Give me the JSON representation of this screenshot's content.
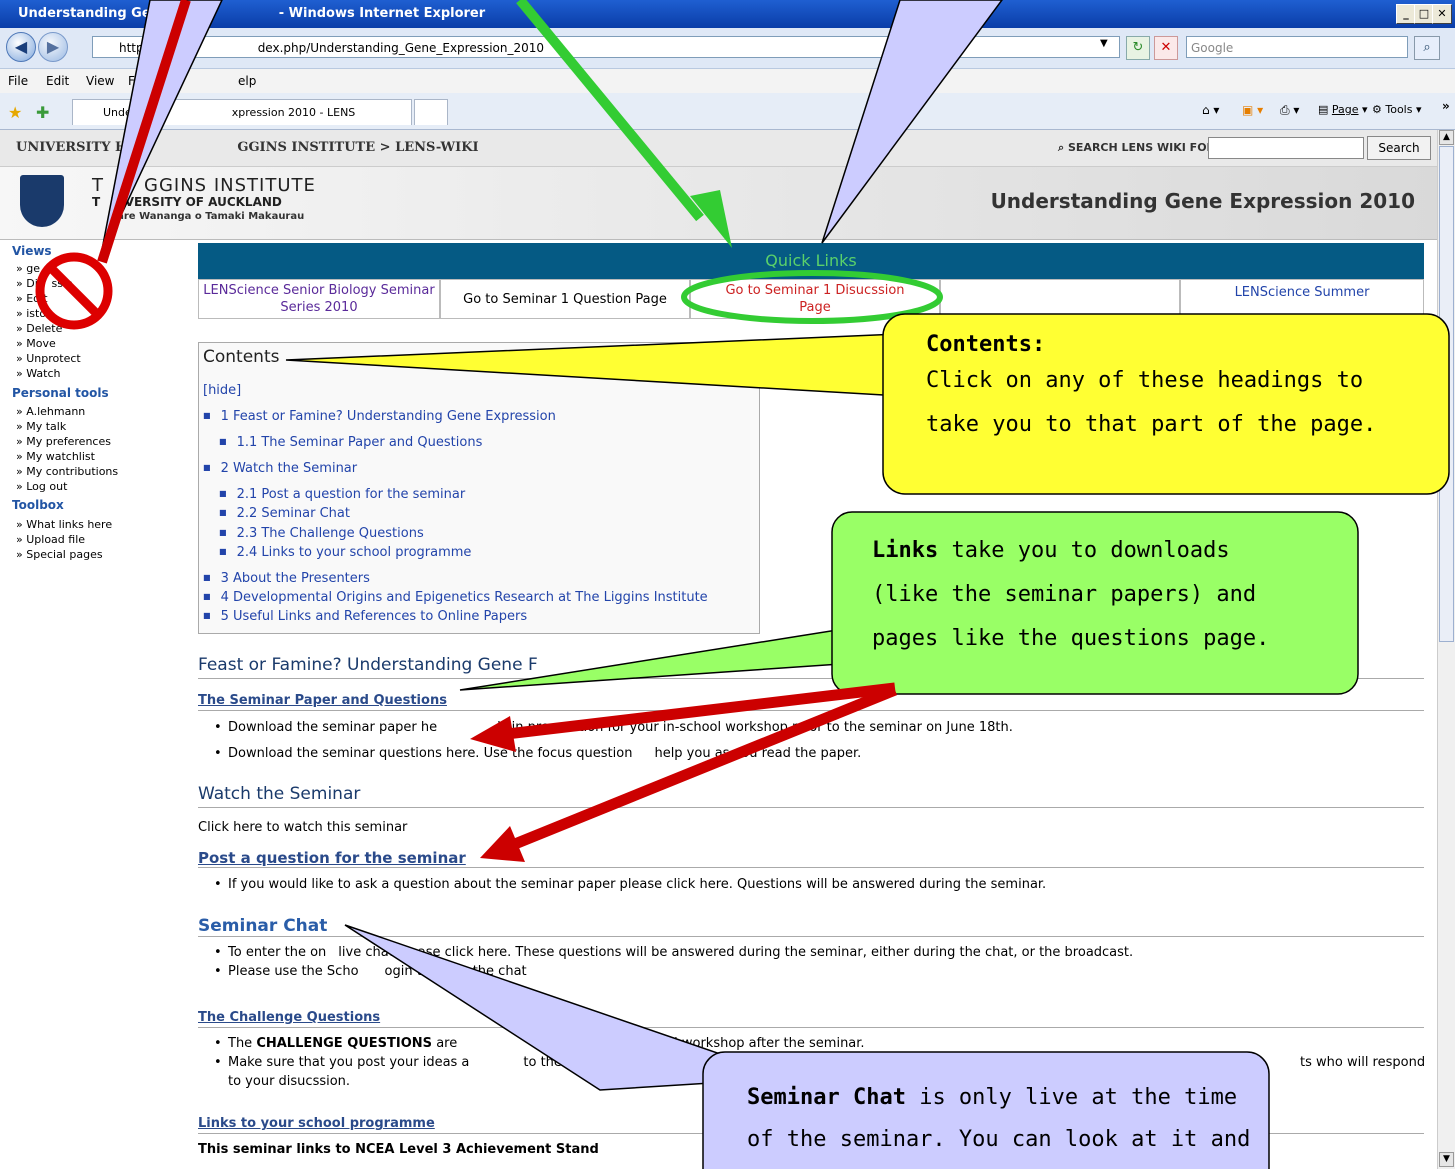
{
  "browser": {
    "title": "Understanding Gene",
    "title_suffix": "- Windows Internet Explorer",
    "url_prefix": "http:",
    "url_suffix": "dex.php/Understanding_Gene_Expression_2010",
    "search_engine": "Google",
    "menu": [
      "File",
      "Edit",
      "View",
      "F",
      "elp"
    ],
    "tab_label_left": "Unde",
    "tab_label_right": "xpression 2010 - LENS",
    "toolbar_page": "Page",
    "toolbar_tools": "Tools"
  },
  "site": {
    "breadcrumb_left": "UNIVERSITY H",
    "breadcrumb_right": "GGINS INSTITUTE > LENS-WIKI",
    "search_label": "SEARCH LENS WIKI FOR",
    "search_button": "Search",
    "institute_name_left": "T",
    "institute_name_right": "GGINS INSTITUTE",
    "university_left": "T",
    "university_right": "NIVERSITY OF AUCKLAND",
    "maori_name": "hare Wananga o Tamaki Makaurau",
    "page_title": "Understanding Gene Expression 2010"
  },
  "sidebar": {
    "views_heading": "Views",
    "views": [
      "ge",
      "Dis",
      "ssio",
      "Edit",
      "istor",
      "Delete",
      "Move",
      "Unprotect",
      "Watch"
    ],
    "personal_heading": "Personal tools",
    "personal": [
      "A.lehmann",
      "My talk",
      "My preferences",
      "My watchlist",
      "My contributions",
      "Log out"
    ],
    "toolbox_heading": "Toolbox",
    "toolbox": [
      "What links here",
      "Upload file",
      "Special pages"
    ]
  },
  "quick_links": {
    "title": "Quick Links",
    "cells": [
      "LENScience Senior Biology Seminar Series 2010",
      "Go to Seminar 1 Question Page",
      "Go to Seminar 1 Disucssion Page",
      "",
      "LENScience Summer"
    ]
  },
  "toc": {
    "heading": "Contents",
    "hide": "[hide]",
    "items": [
      "1 Feast or Famine?  Understanding Gene Expression",
      "1.1 The Seminar Paper and Questions",
      "2 Watch the Seminar",
      "2.1 Post a question for the seminar",
      "2.2 Seminar Chat",
      "2.3 The Challenge Questions",
      "2.4 Links to your school programme",
      "3 About the Presenters",
      "4 Developmental Origins and Epigenetics Research at The Liggins Institute",
      "5 Useful Links and References to Online Papers"
    ]
  },
  "content": {
    "h_feast": "Feast or Famine?  Understanding Gene F",
    "h_paper": "The Seminar Paper and Questions",
    "paper_b1_left": "Download the seminar paper he",
    "paper_b1_right": "is in preparation for your in-school workshop prior to the seminar on June 18th.",
    "paper_b2_left": "Download the seminar questions here.  Use the focus question",
    "paper_b2_right": "help you as you read the paper.",
    "h_watch": "Watch the Seminar",
    "watch_text": "Click here to watch this seminar",
    "h_post": "Post a question for the seminar",
    "post_b1": "If you would like to ask a question about the seminar paper please click here. Questions will be answered during the seminar.",
    "h_chat": "Seminar Chat",
    "chat_b1_left": "To enter the on",
    "chat_b1_right": "live chat please click here.  These questions will be answered during the seminar, either during the chat, or the broadcast.",
    "chat_b2_left": "Please use the Scho",
    "chat_b2_right": "ogin to enter the chat",
    "h_challenge": "The Challenge Questions",
    "ch_b1_left": "The ",
    "ch_b1_bold": "CHALLENGE QUESTIONS",
    "ch_b1_mid": " are",
    "ch_b1_right": "ssion in your school workshop after the seminar.",
    "ch_b2_left": "Make sure that you post your ideas a",
    "ch_b2_mid": "to the challenge",
    "ch_b2_right": "ts who will respond",
    "ch_b2_cont": "to your disucssion.",
    "h_links": "Links to your school programme",
    "links_text": "This seminar links to NCEA Level 3 Achievement Stand"
  },
  "callouts": {
    "contents_title": "Contents:",
    "contents_body_1": "Click on any of these headings to",
    "contents_body_2": "take you to that part of the page.",
    "links_bold": "Links",
    "links_body_1": " take you to downloads",
    "links_body_2": "(like the seminar papers) and",
    "links_body_3": "pages like the questions page.",
    "chat_bold": "Seminar Chat",
    "chat_body_1": " is only live at the time",
    "chat_body_2": "of the seminar. You can look at it and"
  },
  "colors": {
    "quicklinks_bar": "#055a84",
    "callout_yellow": "#ffff33",
    "callout_green": "#99ff66",
    "callout_lavender": "#ccccff",
    "arrow_red": "#cc0000",
    "arrow_green": "#33cc33"
  }
}
